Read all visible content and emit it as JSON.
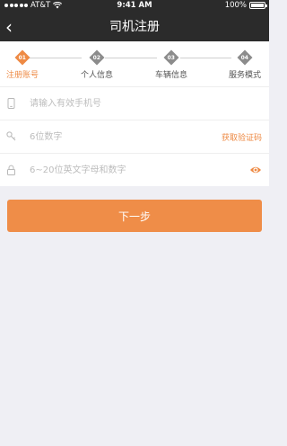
{
  "status_bar": {
    "carrier": "AT&T",
    "time": "9:41 AM",
    "battery": "100%"
  },
  "nav": {
    "back_icon": "chevron-left-icon",
    "back_glyph": "‹",
    "title": "司机注册"
  },
  "steps": [
    {
      "number": "01",
      "label": "注册账号",
      "active": true
    },
    {
      "number": "02",
      "label": "个人信息",
      "active": false
    },
    {
      "number": "03",
      "label": "车辆信息",
      "active": false
    },
    {
      "number": "04",
      "label": "服务模式",
      "active": false
    }
  ],
  "form": {
    "phone": {
      "icon": "phone-icon",
      "placeholder": "请输入有效手机号",
      "value": ""
    },
    "code": {
      "icon": "key-icon",
      "placeholder": "6位数字",
      "value": "",
      "action_label": "获取验证码"
    },
    "password": {
      "icon": "lock-icon",
      "placeholder": "6~20位英文字母和数字",
      "value": "",
      "toggle_icon": "eye-icon"
    }
  },
  "next_button": {
    "label": "下一步"
  },
  "colors": {
    "accent": "#ee8a44",
    "header": "#2b2b2b",
    "background": "#efeff4"
  }
}
